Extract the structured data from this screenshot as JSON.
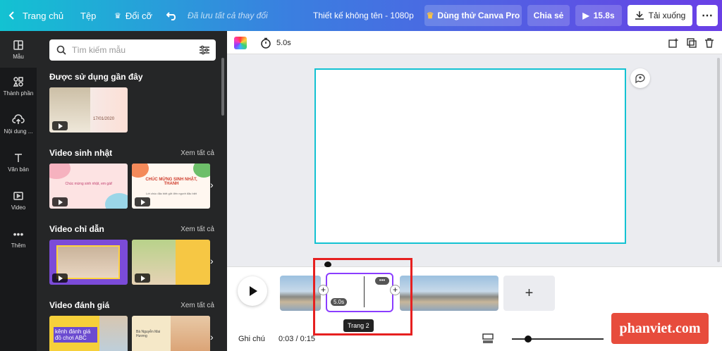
{
  "topbar": {
    "home": "Trang chủ",
    "file": "Tệp",
    "resize": "Đổi cỡ",
    "saved_status": "Đã lưu tất cả thay đổi",
    "doc_title": "Thiết kế không tên - 1080p",
    "pro": "Dùng thử Canva Pro",
    "share": "Chia sẻ",
    "duration": "15.8s",
    "download": "Tải xuống"
  },
  "rail": {
    "items": [
      {
        "label": "Mẫu"
      },
      {
        "label": "Thành phần"
      },
      {
        "label": "Nội dung ..."
      },
      {
        "label": "Văn bản"
      },
      {
        "label": "Video"
      },
      {
        "label": "Thêm"
      }
    ]
  },
  "panel": {
    "search_placeholder": "Tìm kiếm mẫu",
    "sections": [
      {
        "title": "Được sử dụng gần đây",
        "see_all": ""
      },
      {
        "title": "Video sinh nhật",
        "see_all": "Xem tất cả"
      },
      {
        "title": "Video chỉ dẫn",
        "see_all": "Xem tất cả"
      },
      {
        "title": "Video đánh giá",
        "see_all": "Xem tất cả"
      }
    ],
    "thumb_texts": {
      "recent_date": "17/01/2020",
      "bday1": "Chúc mừng sinh nhật, em gái!",
      "bday2_title": "CHÚC MỪNG SINH NHẬT, THANH",
      "bday2_sub": "Lời chúc đặc biệt gửi đến người đặc biệt",
      "review1": "kênh đánh giá đồ chơi ABC",
      "review2": "Bà Nguyễn Mai Hương"
    }
  },
  "editor": {
    "duration": "5.0s"
  },
  "timeline": {
    "clip_duration": "5.0s",
    "page_label": "Trang 2",
    "notes": "Ghi chú",
    "time": "0:03 / 0:15"
  },
  "watermark": "phanviet.com",
  "colors": {
    "accent": "#8b3dff",
    "selection": "#13c2d2",
    "highlight": "#e62020"
  }
}
